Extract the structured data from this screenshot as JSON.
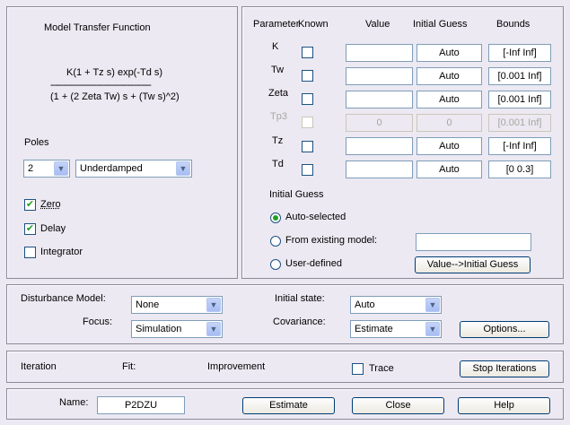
{
  "model": {
    "title": "Model Transfer Function",
    "numerator": "K(1 + Tz s) exp(-Td s)",
    "divider": "------------------------------------------",
    "denominator": "(1 + (2 Zeta Tw) s + (Tw s)^2)",
    "poles_label": "Poles",
    "poles_value": "2",
    "damping_value": "Underdamped",
    "zero_label": "Zero",
    "zero_checked": true,
    "delay_label": "Delay",
    "delay_checked": true,
    "integrator_label": "Integrator",
    "integrator_checked": false
  },
  "params": {
    "headers": {
      "parameter": "Parameter",
      "known": "Known",
      "value": "Value",
      "initial_guess": "Initial Guess",
      "bounds": "Bounds"
    },
    "rows": [
      {
        "name": "K",
        "value": "",
        "guess": "Auto",
        "bounds": "[-Inf Inf]",
        "disabled": false
      },
      {
        "name": "Tw",
        "value": "",
        "guess": "Auto",
        "bounds": "[0.001 Inf]",
        "disabled": false
      },
      {
        "name": "Zeta",
        "value": "",
        "guess": "Auto",
        "bounds": "[0.001 Inf]",
        "disabled": false
      },
      {
        "name": "Tp3",
        "value": "0",
        "guess": "0",
        "bounds": "[0.001 Inf]",
        "disabled": true
      },
      {
        "name": "Tz",
        "value": "",
        "guess": "Auto",
        "bounds": "[-Inf Inf]",
        "disabled": false
      },
      {
        "name": "Td",
        "value": "",
        "guess": "Auto",
        "bounds": "[0 0.3]",
        "disabled": false
      }
    ],
    "initial_guess_label": "Initial Guess",
    "radio_auto": "Auto-selected",
    "radio_existing": "From existing model:",
    "radio_user": "User-defined",
    "existing_model_value": "",
    "value_to_guess_button": "Value-->Initial Guess"
  },
  "settings": {
    "disturbance_label": "Disturbance Model:",
    "disturbance_value": "None",
    "focus_label": "Focus:",
    "focus_value": "Simulation",
    "initial_state_label": "Initial state:",
    "initial_state_value": "Auto",
    "covariance_label": "Covariance:",
    "covariance_value": "Estimate",
    "options_button": "Options..."
  },
  "iteration": {
    "iteration_label": "Iteration",
    "fit_label": "Fit:",
    "improvement_label": "Improvement",
    "trace_label": "Trace",
    "stop_button": "Stop Iterations"
  },
  "footer": {
    "name_label": "Name:",
    "name_value": "P2DZU",
    "estimate_button": "Estimate",
    "close_button": "Close",
    "help_button": "Help"
  }
}
